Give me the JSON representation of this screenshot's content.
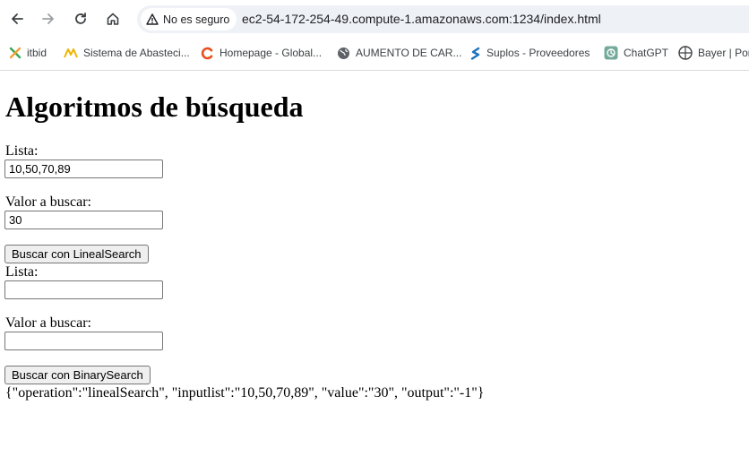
{
  "browser": {
    "security_chip": "No es seguro",
    "url": "ec2-54-172-254-49.compute-1.amazonaws.com:1234/index.html",
    "bookmarks": [
      {
        "label": "itbid",
        "icon": "itbid-icon"
      },
      {
        "label": "Sistema de Abasteci...",
        "icon": "sistema-logo-icon"
      },
      {
        "label": "Homepage - Global...",
        "icon": "homepage-c-icon"
      },
      {
        "label": "AUMENTO DE CAR...",
        "icon": "globe-icon"
      },
      {
        "label": "Suplos - Proveedores",
        "icon": "suplos-icon"
      },
      {
        "label": "ChatGPT",
        "icon": "chatgpt-icon"
      },
      {
        "label": "Bayer | Por",
        "icon": "bayer-icon"
      }
    ]
  },
  "page": {
    "title": "Algoritmos de búsqueda",
    "linear": {
      "list_label": "Lista:",
      "list_value": "10,50,70,89",
      "value_label": "Valor a buscar:",
      "value_value": "30",
      "button": "Buscar con LinealSearch"
    },
    "binary": {
      "list_label": "Lista:",
      "list_value": "",
      "value_label": "Valor a buscar:",
      "value_value": "",
      "button": "Buscar con BinarySearch"
    },
    "result": "{\"operation\":\"linealSearch\", \"inputlist\":\"10,50,70,89\", \"value\":\"30\", \"output\":\"-1\"}"
  }
}
